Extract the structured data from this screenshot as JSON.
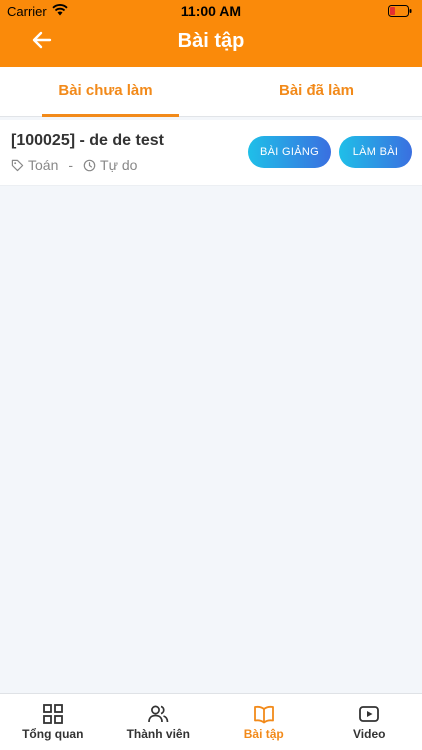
{
  "status_bar": {
    "carrier": "Carrier",
    "time": "11:00 AM"
  },
  "header": {
    "title": "Bài tập"
  },
  "tabs": [
    {
      "label": "Bài chưa làm",
      "active": true
    },
    {
      "label": "Bài đã làm",
      "active": false
    }
  ],
  "exercises": [
    {
      "title": "[100025] - de de test",
      "subject": "Toán",
      "separator": "-",
      "mode": "Tự do",
      "lecture_button": "BÀI GIẢNG",
      "do_button": "LÀM BÀI"
    }
  ],
  "tabbar": {
    "items": [
      {
        "label": "Tổng quan",
        "icon": "grid-icon",
        "active": false
      },
      {
        "label": "Thành viên",
        "icon": "users-icon",
        "active": false
      },
      {
        "label": "Bài tập",
        "icon": "book-icon",
        "active": true
      },
      {
        "label": "Video",
        "icon": "video-icon",
        "active": false
      }
    ]
  },
  "colors": {
    "primary": "#fa8a0a",
    "accent": "#f28a1a",
    "button_start": "#1fbfe8",
    "button_end": "#3a6fe0"
  }
}
